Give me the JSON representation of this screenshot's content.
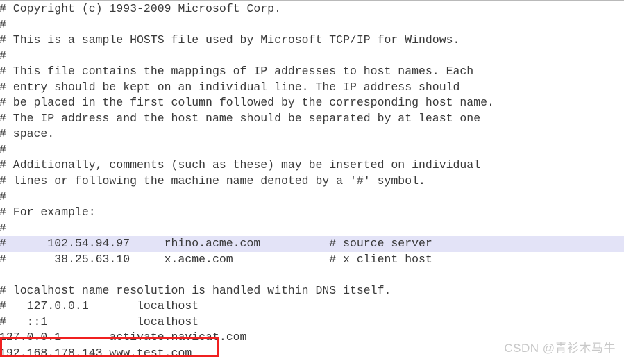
{
  "app": {
    "kind": "text-editor",
    "document_name": "hosts",
    "colors": {
      "background": "#ffffff",
      "text": "#3a3a3a",
      "selection_highlight": "#e3e3f7",
      "annotation_box": "#f02020",
      "top_rule": "#b9b9b9",
      "watermark": "#c8c8c8"
    }
  },
  "editor": {
    "lines": [
      {
        "text": "# Copyright (c) 1993-2009 Microsoft Corp.",
        "selected": false
      },
      {
        "text": "#",
        "selected": false
      },
      {
        "text": "# This is a sample HOSTS file used by Microsoft TCP/IP for Windows.",
        "selected": false
      },
      {
        "text": "#",
        "selected": false
      },
      {
        "text": "# This file contains the mappings of IP addresses to host names. Each",
        "selected": false
      },
      {
        "text": "# entry should be kept on an individual line. The IP address should",
        "selected": false
      },
      {
        "text": "# be placed in the first column followed by the corresponding host name.",
        "selected": false
      },
      {
        "text": "# The IP address and the host name should be separated by at least one",
        "selected": false
      },
      {
        "text": "# space.",
        "selected": false
      },
      {
        "text": "#",
        "selected": false
      },
      {
        "text": "# Additionally, comments (such as these) may be inserted on individual",
        "selected": false
      },
      {
        "text": "# lines or following the machine name denoted by a '#' symbol.",
        "selected": false
      },
      {
        "text": "#",
        "selected": false
      },
      {
        "text": "# For example:",
        "selected": false
      },
      {
        "text": "#",
        "selected": false
      },
      {
        "text": "#      102.54.94.97     rhino.acme.com          # source server",
        "selected": true
      },
      {
        "text": "#       38.25.63.10     x.acme.com              # x client host",
        "selected": false
      },
      {
        "text": "",
        "selected": false
      },
      {
        "text": "# localhost name resolution is handled within DNS itself.",
        "selected": false
      },
      {
        "text": "#   127.0.0.1       localhost",
        "selected": false
      },
      {
        "text": "#   ::1             localhost",
        "selected": false
      },
      {
        "text": "127.0.0.1       activate.navicat.com",
        "selected": false
      },
      {
        "text": "192.168.178.143 www.test.com",
        "selected": false
      }
    ]
  },
  "annotation": {
    "red_box_label": "192.168.178.143 www.test.com",
    "red_box_target_line_index": 22
  },
  "watermark": {
    "text": "CSDN @青衫木马牛"
  }
}
